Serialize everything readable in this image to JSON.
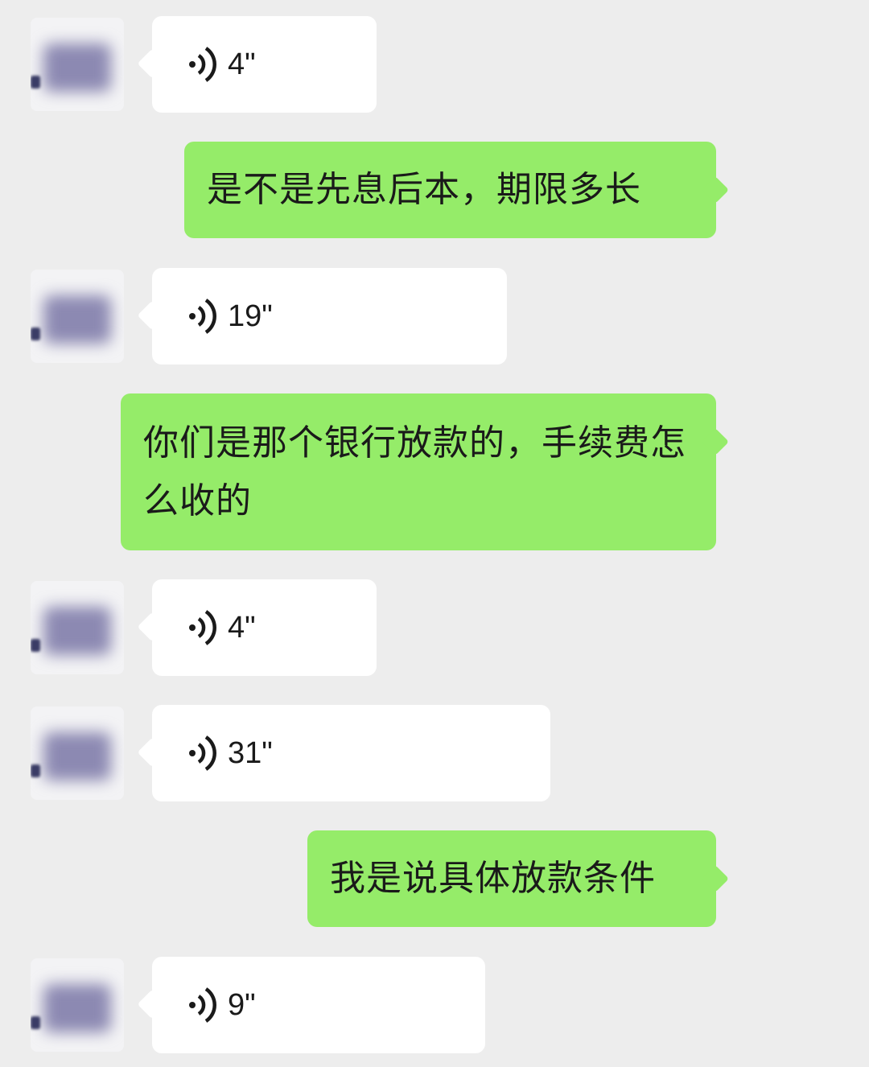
{
  "chat": {
    "messages": [
      {
        "side": "in",
        "type": "voice",
        "duration": "4\""
      },
      {
        "side": "out",
        "type": "text",
        "text": "是不是先息后本，期限多长"
      },
      {
        "side": "in",
        "type": "voice",
        "duration": "19\""
      },
      {
        "side": "out",
        "type": "text",
        "text": "你们是那个银行放款的，手续费怎么收的"
      },
      {
        "side": "in",
        "type": "voice",
        "duration": "4\""
      },
      {
        "side": "in",
        "type": "voice",
        "duration": "31\""
      },
      {
        "side": "out",
        "type": "text",
        "text": "我是说具体放款条件"
      },
      {
        "side": "in",
        "type": "voice",
        "duration": "9\""
      }
    ]
  },
  "colors": {
    "background": "#ededed",
    "incoming_bubble": "#ffffff",
    "outgoing_bubble": "#95ec69",
    "text": "#1a1a1a"
  },
  "icons": {
    "voice": "voice-wave-icon",
    "avatar": "blurred-avatar"
  }
}
